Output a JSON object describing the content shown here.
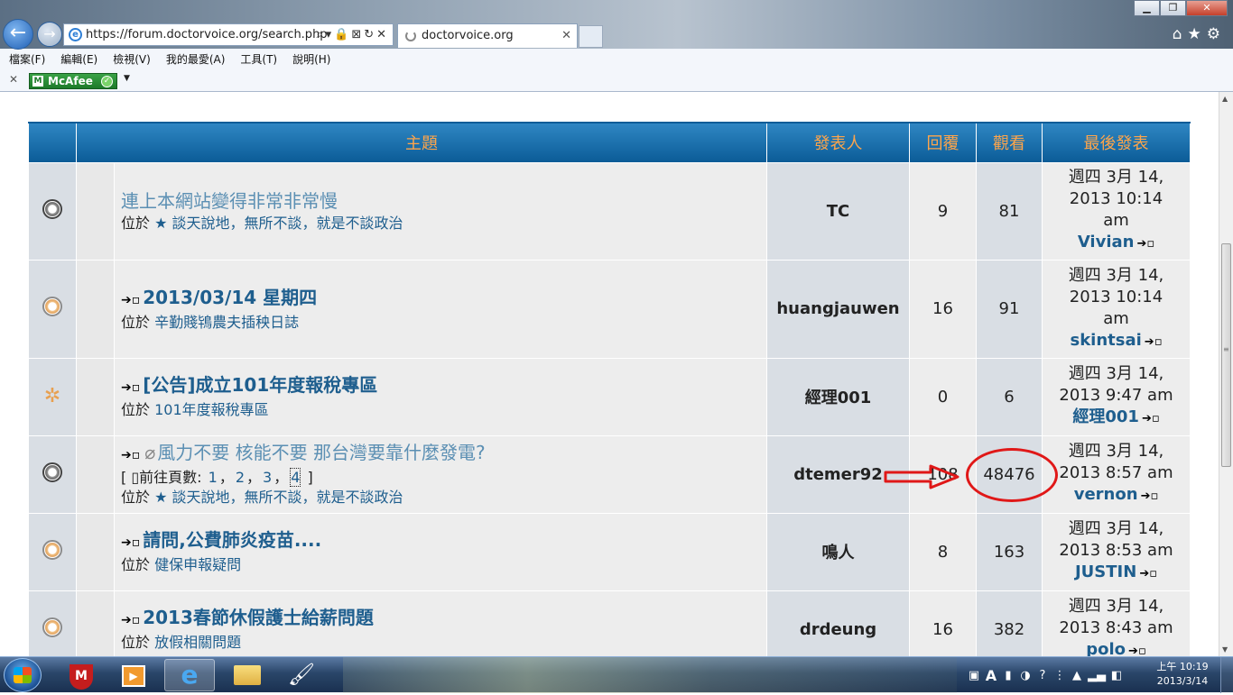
{
  "browser": {
    "address": "https://forum.doctorvoice.org/search.php",
    "address_domain": "doctorvoice.org",
    "tab_title": "doctorvoice.org",
    "menu": [
      "檔案(F)",
      "編輯(E)",
      "檢視(V)",
      "我的最愛(A)",
      "工具(T)",
      "說明(H)"
    ],
    "mcafee_label": "McAfee"
  },
  "table": {
    "headers": {
      "topic": "主題",
      "author": "發表人",
      "replies": "回覆",
      "views": "觀看",
      "last_post": "最後發表"
    },
    "location_prefix": "位於",
    "pages_prefix": "前往頁數:",
    "rows": [
      {
        "title": "連上本網站變得非常非常慢",
        "visited": true,
        "has_arrow": false,
        "forum": "談天說地，無所不談，就是不談政治",
        "forum_star": true,
        "author": "TC",
        "replies": "9",
        "views": "81",
        "last_date": "週四 3月 14,",
        "last_time": "2013 10:14",
        "last_ampm": "am",
        "last_user": "Vivian",
        "icon": "dark"
      },
      {
        "title": "2013/03/14 星期四",
        "visited": false,
        "has_arrow": true,
        "forum": "辛勤賤鴇農夫插秧日誌",
        "forum_star": false,
        "author": "huangjauwen",
        "replies": "16",
        "views": "91",
        "last_date": "週四 3月 14,",
        "last_time": "2013 10:14",
        "last_ampm": "am",
        "last_user": "skintsai",
        "icon": "normal"
      },
      {
        "title": "[公告]成立101年度報稅專區",
        "visited": false,
        "has_arrow": true,
        "forum": "101年度報稅專區",
        "forum_star": false,
        "author": "經理001",
        "replies": "0",
        "views": "6",
        "last_date": "週四 3月 14,",
        "last_time": "2013 9:47 am",
        "last_ampm": "",
        "last_user": "經理001",
        "icon": "star"
      },
      {
        "title": "風力不要 核能不要 那台灣要靠什麼發電?",
        "visited": true,
        "has_arrow": true,
        "has_clip": true,
        "pages": [
          "1",
          "2",
          "3",
          "4"
        ],
        "forum": "談天說地，無所不談，就是不談政治",
        "forum_star": true,
        "author": "dtemer92",
        "replies": "108",
        "views": "48476",
        "last_date": "週四 3月 14,",
        "last_time": "2013 8:57 am",
        "last_ampm": "",
        "last_user": "vernon",
        "icon": "dark"
      },
      {
        "title": "請問,公費肺炎疫苗....",
        "visited": false,
        "has_arrow": true,
        "forum": "健保申報疑問",
        "forum_star": false,
        "author": "鳴人",
        "replies": "8",
        "views": "163",
        "last_date": "週四 3月 14,",
        "last_time": "2013 8:53 am",
        "last_ampm": "",
        "last_user": "JUSTIN",
        "icon": "normal"
      },
      {
        "title": "2013春節休假護士給薪問題",
        "visited": false,
        "has_arrow": true,
        "forum": "放假相關問題",
        "forum_star": false,
        "author": "drdeung",
        "replies": "16",
        "views": "382",
        "last_date": "週四 3月 14,",
        "last_time": "2013 8:43 am",
        "last_ampm": "",
        "last_user": "polo",
        "icon": "normal"
      }
    ]
  },
  "taskbar": {
    "clock_time": "上午 10:19",
    "clock_date": "2013/3/14"
  },
  "colors": {
    "header_bg": "#0b5c97",
    "header_text": "#ffa54a",
    "link": "#1e5e8e",
    "annotation": "#e01818"
  }
}
